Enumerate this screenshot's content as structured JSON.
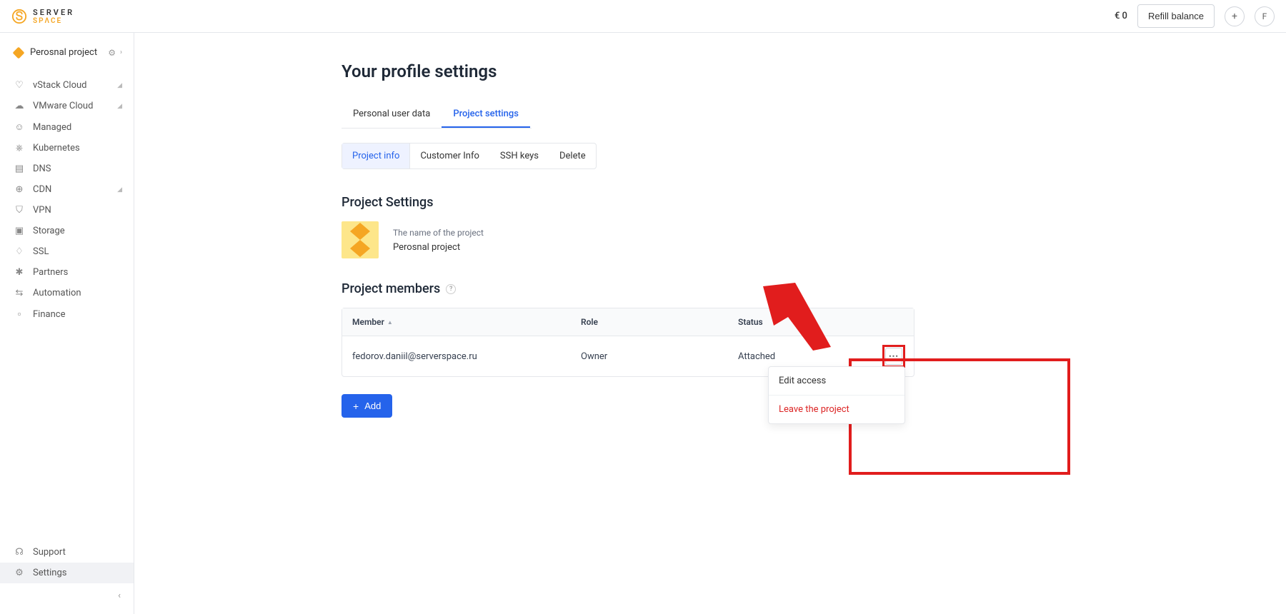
{
  "header": {
    "brand_line1": "SERVER",
    "brand_line2": "SPΛCE",
    "balance": "€ 0",
    "refill_label": "Refill balance",
    "avatar_initial": "F"
  },
  "sidebar": {
    "project_name": "Perosnal project",
    "items": [
      {
        "label": "vStack Cloud",
        "expandable": true
      },
      {
        "label": "VMware Cloud",
        "expandable": true
      },
      {
        "label": "Managed",
        "expandable": false
      },
      {
        "label": "Kubernetes",
        "expandable": false
      },
      {
        "label": "DNS",
        "expandable": false
      },
      {
        "label": "CDN",
        "expandable": true
      },
      {
        "label": "VPN",
        "expandable": false
      },
      {
        "label": "Storage",
        "expandable": false
      },
      {
        "label": "SSL",
        "expandable": false
      },
      {
        "label": "Partners",
        "expandable": false
      },
      {
        "label": "Automation",
        "expandable": false
      },
      {
        "label": "Finance",
        "expandable": false
      }
    ],
    "bottom": [
      {
        "label": "Support"
      },
      {
        "label": "Settings"
      }
    ]
  },
  "page": {
    "title": "Your profile settings",
    "tabs_primary": [
      {
        "label": "Personal user data",
        "active": false
      },
      {
        "label": "Project settings",
        "active": true
      }
    ],
    "tabs_secondary": [
      {
        "label": "Project info",
        "active": true
      },
      {
        "label": "Customer Info",
        "active": false
      },
      {
        "label": "SSH keys",
        "active": false
      },
      {
        "label": "Delete",
        "active": false
      }
    ],
    "project_section_title": "Project Settings",
    "project_name_label": "The name of the project",
    "project_name_value": "Perosnal project",
    "members_section_title": "Project members",
    "table": {
      "headers": {
        "member": "Member",
        "role": "Role",
        "status": "Status"
      },
      "rows": [
        {
          "member": "fedorov.daniil@serverspace.ru",
          "role": "Owner",
          "status": "Attached"
        }
      ]
    },
    "dropdown": {
      "edit": "Edit access",
      "leave": "Leave the project"
    },
    "add_label": "Add"
  }
}
